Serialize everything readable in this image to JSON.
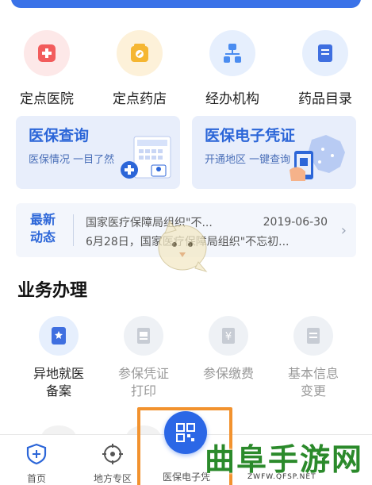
{
  "quick_entries": [
    {
      "label": "定点医院",
      "icon": "hospital-icon",
      "color": "#f25c5c",
      "bg": "#fde8e8"
    },
    {
      "label": "定点药店",
      "icon": "pharmacy-icon",
      "color": "#f5b632",
      "bg": "#fdf1d9"
    },
    {
      "label": "经办机构",
      "icon": "agency-icon",
      "color": "#4a8cf0",
      "bg": "#e6effd"
    },
    {
      "label": "药品目录",
      "icon": "catalog-icon",
      "color": "#3f6fe0",
      "bg": "#e6effd"
    }
  ],
  "cards": [
    {
      "title": "医保查询",
      "subtitle": "医保情况 一目了然",
      "icon": "insurance-query-icon"
    },
    {
      "title": "医保电子凭证",
      "subtitle": "开通地区 一键查询",
      "icon": "e-voucher-map-icon"
    }
  ],
  "news": {
    "tag_line1": "最新",
    "tag_line2": "动态",
    "line1": "国家医疗保障局组织\"不...",
    "date": "2019-06-30",
    "line2": "6月28日，国家医疗保障局组织\"不忘初..."
  },
  "section_title": "业务办理",
  "services": [
    {
      "label_line1": "异地就医",
      "label_line2": "备案",
      "icon": "remote-medical-icon",
      "active": true
    },
    {
      "label_line1": "参保凭证",
      "label_line2": "打印",
      "icon": "print-certificate-icon",
      "active": false
    },
    {
      "label_line1": "参保缴费",
      "label_line2": "",
      "icon": "yuan-payment-icon",
      "active": false
    },
    {
      "label_line1": "基本信息",
      "label_line2": "变更",
      "icon": "info-change-icon",
      "active": false
    }
  ],
  "bottom_nav": [
    {
      "label": "首页",
      "icon": "home-shield-icon"
    },
    {
      "label": "地方专区",
      "icon": "location-target-icon"
    },
    {
      "label": "医保电子凭",
      "icon": "qr-code-icon"
    }
  ],
  "watermark": {
    "main": "曲阜手游网",
    "url": "ZWFW.QFSP.NET"
  },
  "colors": {
    "primary": "#2c66d8",
    "highlight_border": "#f2922e",
    "watermark_green": "#2b8a2b"
  }
}
